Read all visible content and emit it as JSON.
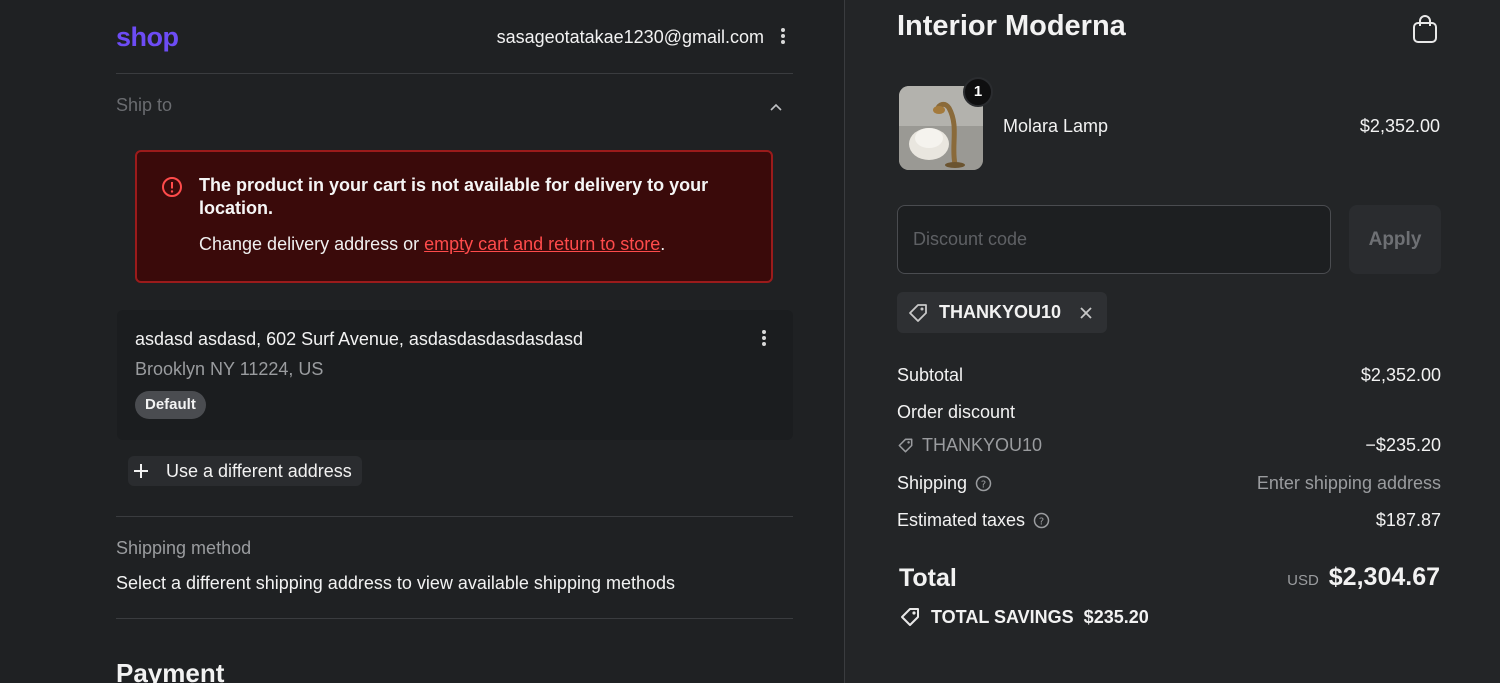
{
  "header": {
    "logo": "shop",
    "email": "sasageotatakae1230@gmail.com"
  },
  "ship_to": {
    "label": "Ship to",
    "error": {
      "message": "The product in your cart is not available for delivery to your location.",
      "prefix": "Change delivery address or ",
      "link": "empty cart and return to store",
      "suffix": "."
    },
    "address": {
      "line1": "asdasd asdasd, 602 Surf Avenue, asdasdasdasdasdasd",
      "line2": "Brooklyn NY 11224, US",
      "badge": "Default"
    },
    "use_different": "Use a different address"
  },
  "shipping_method": {
    "label": "Shipping method",
    "text": "Select a different shipping address to view available shipping methods"
  },
  "payment": {
    "title": "Payment"
  },
  "summary": {
    "store_name": "Interior Moderna",
    "product": {
      "name": "Molara Lamp",
      "price": "$2,352.00",
      "quantity": "1"
    },
    "discount": {
      "placeholder": "Discount code",
      "apply": "Apply",
      "applied_code": "THANKYOU10"
    },
    "subtotal": {
      "label": "Subtotal",
      "value": "$2,352.00"
    },
    "order_discount": {
      "label": "Order discount",
      "code": "THANKYOU10",
      "value": "−$235.20"
    },
    "shipping": {
      "label": "Shipping",
      "value": "Enter shipping address"
    },
    "taxes": {
      "label": "Estimated taxes",
      "value": "$187.87"
    },
    "total": {
      "label": "Total",
      "currency": "USD",
      "value": "$2,304.67"
    },
    "savings": "TOTAL SAVINGS  $235.20"
  },
  "colors": {
    "brand": "#6d4cf5",
    "error_bg": "#3a0a0a",
    "error_border": "#9b1b1b",
    "error_link": "#ff4b4b"
  }
}
